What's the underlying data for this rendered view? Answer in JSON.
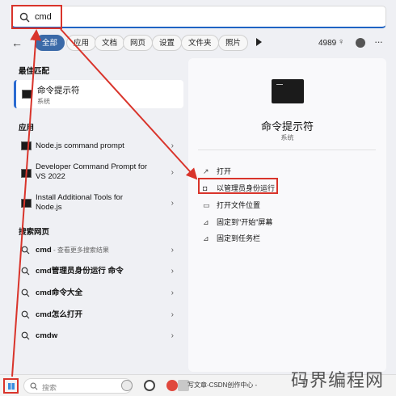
{
  "search": {
    "value": "cmd"
  },
  "filters": {
    "chips": [
      "全部",
      "应用",
      "文档",
      "网页",
      "设置",
      "文件夹",
      "照片"
    ],
    "points": "4989",
    "more_icon": "more-icon"
  },
  "left": {
    "best_match_title": "最佳匹配",
    "best_match": {
      "title": "命令提示符",
      "subtitle": "系统"
    },
    "apps_title": "应用",
    "apps": [
      {
        "label": "Node.js command prompt"
      },
      {
        "label": "Developer Command Prompt for VS 2022"
      },
      {
        "label": "Install Additional Tools for Node.js"
      }
    ],
    "web_title": "搜索网页",
    "web": [
      {
        "bold": "cmd",
        "hint": " - 查看更多搜索结果"
      },
      {
        "bold": "cmd管理员身份运行 命令",
        "hint": ""
      },
      {
        "bold": "cmd命令大全",
        "hint": ""
      },
      {
        "bold": "cmd怎么打开",
        "hint": ""
      },
      {
        "bold": "cmdw",
        "hint": ""
      }
    ]
  },
  "detail": {
    "title": "命令提示符",
    "subtitle": "系统",
    "actions": [
      "打开",
      "以管理员身份运行",
      "打开文件位置",
      "固定到\"开始\"屏幕",
      "固定到任务栏"
    ]
  },
  "taskbar": {
    "search_placeholder": "搜索",
    "task_label": "写文章-CSDN创作中心 -",
    "text_icon_label": "T"
  },
  "watermark": "码界编程网",
  "colors": {
    "accent": "#3b6aa8",
    "annotation": "#d9342b"
  }
}
